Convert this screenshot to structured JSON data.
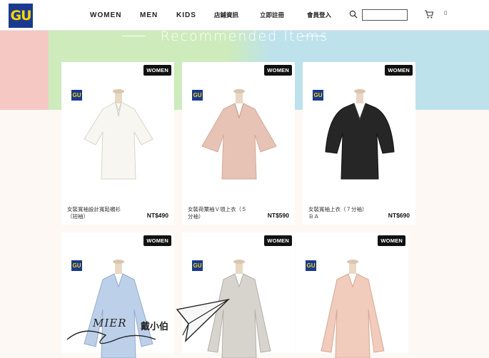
{
  "header": {
    "logo_text": "GU",
    "nav": {
      "women": "WOMEN",
      "men": "MEN",
      "kids": "KIDS",
      "store_info": "店鋪資訊",
      "register": "立即註冊",
      "login": "會員登入"
    },
    "search_placeholder": "",
    "cart_count": "0"
  },
  "banner": {
    "title": "Recommended Items",
    "colors": {
      "pink": "#f6c8c4",
      "green": "#cdebbb",
      "blue": "#bde2ec"
    }
  },
  "products": [
    {
      "tag": "WOMEN",
      "logo": "GU",
      "name_line1": "女裝寬袖設計寬鬆襯衫",
      "name_line2": "（短袖）",
      "price": "NT$490",
      "color": "#f8f6f1"
    },
    {
      "tag": "WOMEN",
      "logo": "GU",
      "name_line1": "女裝荷葉袖Ｖ領上衣（５",
      "name_line2": "分袖）",
      "price": "NT$590",
      "color": "#e7c3b5"
    },
    {
      "tag": "WOMEN",
      "logo": "GU",
      "name_line1": "女裝寬袖上衣（７分袖）",
      "name_line2": "ＢＡ",
      "price": "NT$690",
      "color": "#262626"
    },
    {
      "tag": "WOMEN",
      "logo": "GU",
      "color": "#bcd0ea"
    },
    {
      "tag": "WOMEN",
      "logo": "GU",
      "color": "#d6d4cc"
    },
    {
      "tag": "WOMEN",
      "logo": "GU",
      "color": "#f1cbbb"
    }
  ],
  "watermark": {
    "text": "MIER",
    "text2": "戴小伯"
  }
}
